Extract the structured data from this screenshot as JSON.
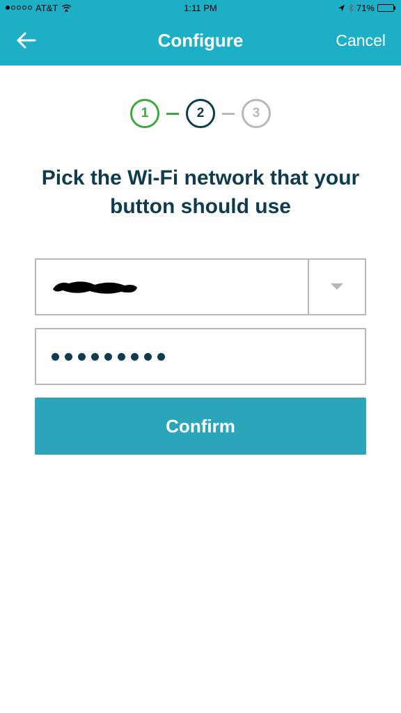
{
  "status": {
    "carrier": "AT&T",
    "time": "1:11 PM",
    "battery_pct": "71%"
  },
  "nav": {
    "title": "Configure",
    "cancel": "Cancel"
  },
  "stepper": {
    "step1": "1",
    "step2": "2",
    "step3": "3"
  },
  "heading": "Pick the Wi-Fi network that your button should use",
  "form": {
    "network_value": "",
    "password_value": "●●●●●●●●●",
    "confirm_label": "Confirm"
  }
}
